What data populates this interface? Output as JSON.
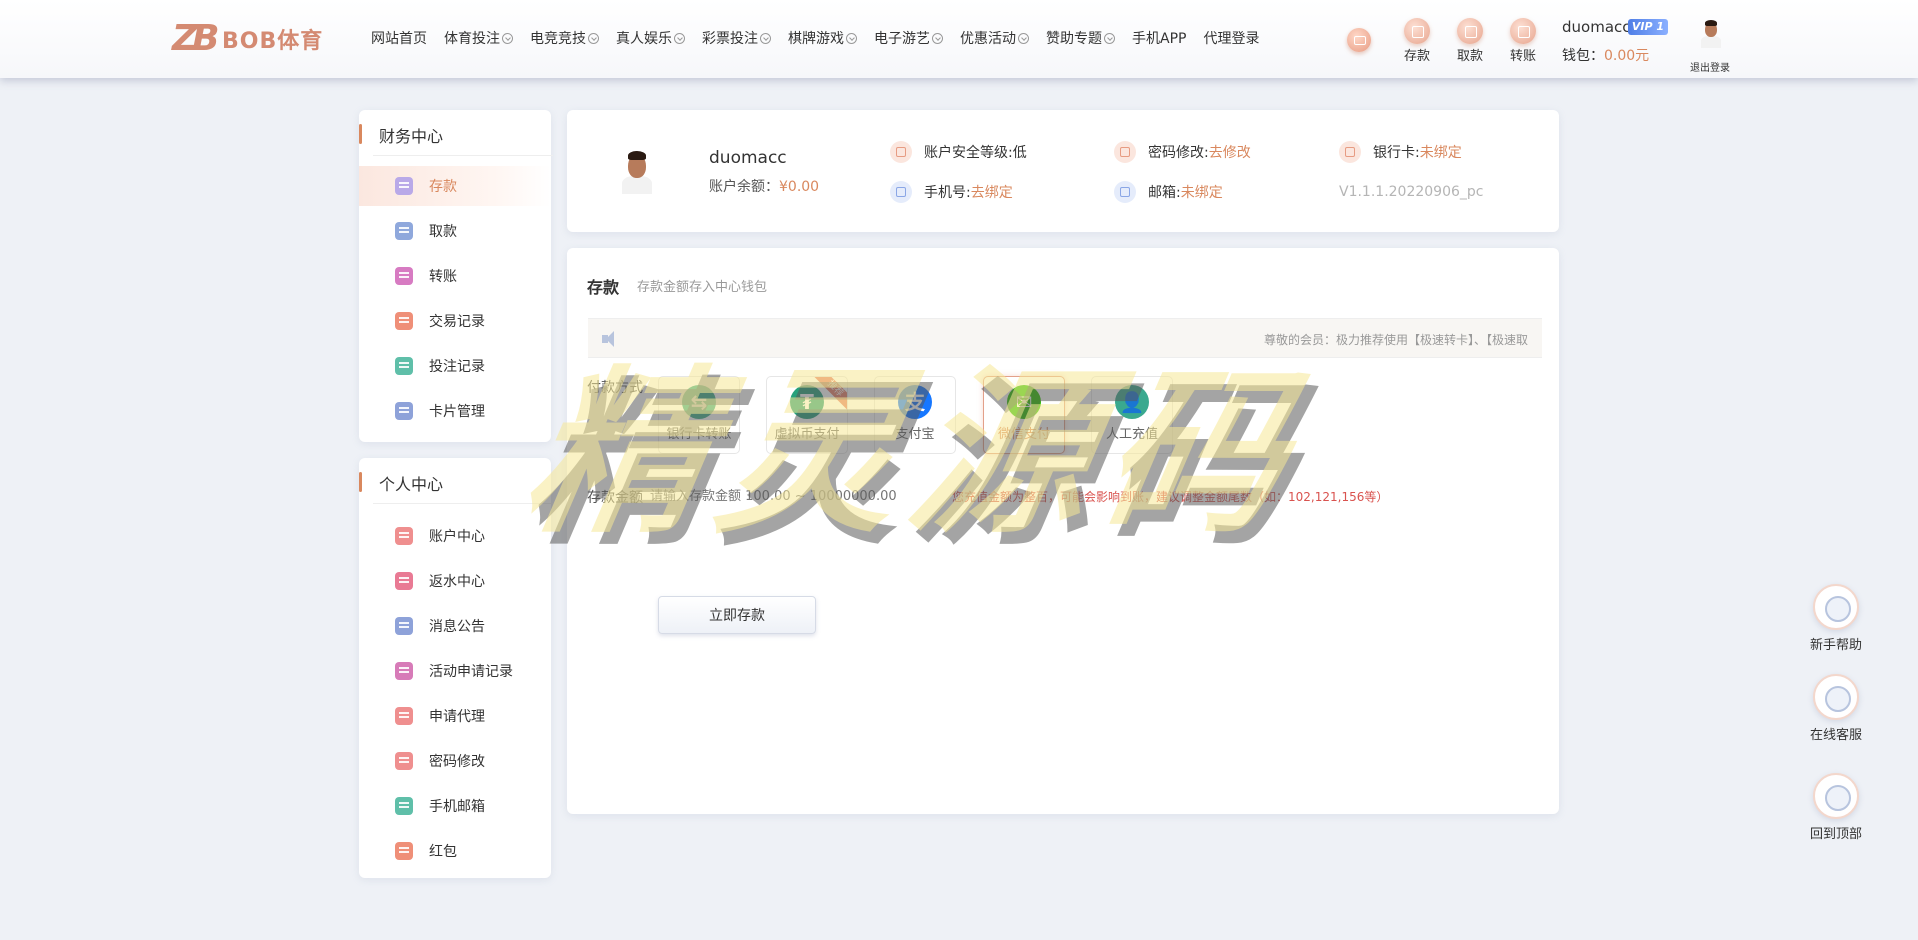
{
  "header": {
    "logo_text": "BOB体育",
    "nav": [
      {
        "label": "网站首页",
        "dropdown": false
      },
      {
        "label": "体育投注",
        "dropdown": true
      },
      {
        "label": "电竞竞技",
        "dropdown": true
      },
      {
        "label": "真人娱乐",
        "dropdown": true
      },
      {
        "label": "彩票投注",
        "dropdown": true
      },
      {
        "label": "棋牌游戏",
        "dropdown": true
      },
      {
        "label": "电子游艺",
        "dropdown": true
      },
      {
        "label": "优惠活动",
        "dropdown": true
      },
      {
        "label": "赞助专题",
        "dropdown": true
      },
      {
        "label": "手机APP",
        "dropdown": false
      },
      {
        "label": "代理登录",
        "dropdown": false
      }
    ],
    "quick": {
      "deposit": "存款",
      "withdraw": "取款",
      "transfer": "转账"
    },
    "username": "duomacc",
    "vip": "VIP 1",
    "wallet_label": "钱包：",
    "wallet_amount": "0.00元",
    "logout": "退出登录"
  },
  "sidebar": {
    "finance_title": "财务中心",
    "finance_items": [
      {
        "label": "存款",
        "icon": "deposit-icon",
        "color": "#b9a9e8",
        "active": true
      },
      {
        "label": "取款",
        "icon": "folder-icon",
        "color": "#8fa8dc",
        "active": false
      },
      {
        "label": "转账",
        "icon": "transfer-icon",
        "color": "#d77bc2",
        "active": false
      },
      {
        "label": "交易记录",
        "icon": "record-icon",
        "color": "#ef8f78",
        "active": false
      },
      {
        "label": "投注记录",
        "icon": "bet-record-icon",
        "color": "#5fbfa9",
        "active": false
      },
      {
        "label": "卡片管理",
        "icon": "card-icon",
        "color": "#8ea2d9",
        "active": false
      }
    ],
    "personal_title": "个人中心",
    "personal_items": [
      {
        "label": "账户中心",
        "icon": "diamond-icon",
        "color": "#ef8f8f"
      },
      {
        "label": "返水中心",
        "icon": "gift-icon",
        "color": "#e97a94"
      },
      {
        "label": "消息公告",
        "icon": "bell-icon",
        "color": "#8ea2d9"
      },
      {
        "label": "活动申请记录",
        "icon": "person-icon",
        "color": "#d77bb8"
      },
      {
        "label": "申请代理",
        "icon": "agent-icon",
        "color": "#ef8f8f"
      },
      {
        "label": "密码修改",
        "icon": "lock-icon",
        "color": "#ef8f8f"
      },
      {
        "label": "手机邮箱",
        "icon": "mail-icon",
        "color": "#5fbfa9"
      },
      {
        "label": "红包",
        "icon": "red-packet-icon",
        "color": "#ef8f78"
      }
    ]
  },
  "info": {
    "username": "duomacc",
    "balance_label": "账户余额：",
    "balance": "¥0.00",
    "security_label": "账户安全等级: ",
    "security_value": "低",
    "password_label": "密码修改: ",
    "password_link": "去修改",
    "bankcard_label": "银行卡: ",
    "bankcard_value": "未绑定",
    "phone_label": "手机号: ",
    "phone_link": "去绑定",
    "email_label": "邮箱: ",
    "email_value": "未绑定",
    "version": "V1.1.1.20220906_pc"
  },
  "deposit": {
    "title": "存款",
    "subtitle": "存款金额存入中心钱包",
    "notice": "尊敬的会员：极力推荐使用【极速转卡】、【极速取",
    "pay_label": "付款方式",
    "methods": [
      {
        "label": "银行卡转账",
        "glyph": "⇆",
        "color": "#3fb08a",
        "selected": false,
        "tag": ""
      },
      {
        "label": "虚拟币支付",
        "glyph": "₮",
        "color": "#26a17b",
        "selected": false,
        "tag": "推荐"
      },
      {
        "label": "支付宝",
        "glyph": "支",
        "color": "#1677ff",
        "selected": false,
        "tag": ""
      },
      {
        "label": "微信支付",
        "glyph": "✉",
        "color": "#2dc100",
        "selected": true,
        "tag": ""
      },
      {
        "label": "人工充值",
        "glyph": "👤",
        "color": "#3aa98f",
        "selected": false,
        "tag": ""
      }
    ],
    "amount_label": "存款金额",
    "amount_placeholder": "请输入存款金额 100.00 ~ 10000000.00",
    "warning": "您充值金额为整百，可能会影响到账，建议调整金额尾数（如：102,121,156等）",
    "submit": "立即存款"
  },
  "watermark": "精灵源码",
  "float": {
    "help": "新手帮助",
    "service": "在线客服",
    "top": "回到顶部"
  }
}
